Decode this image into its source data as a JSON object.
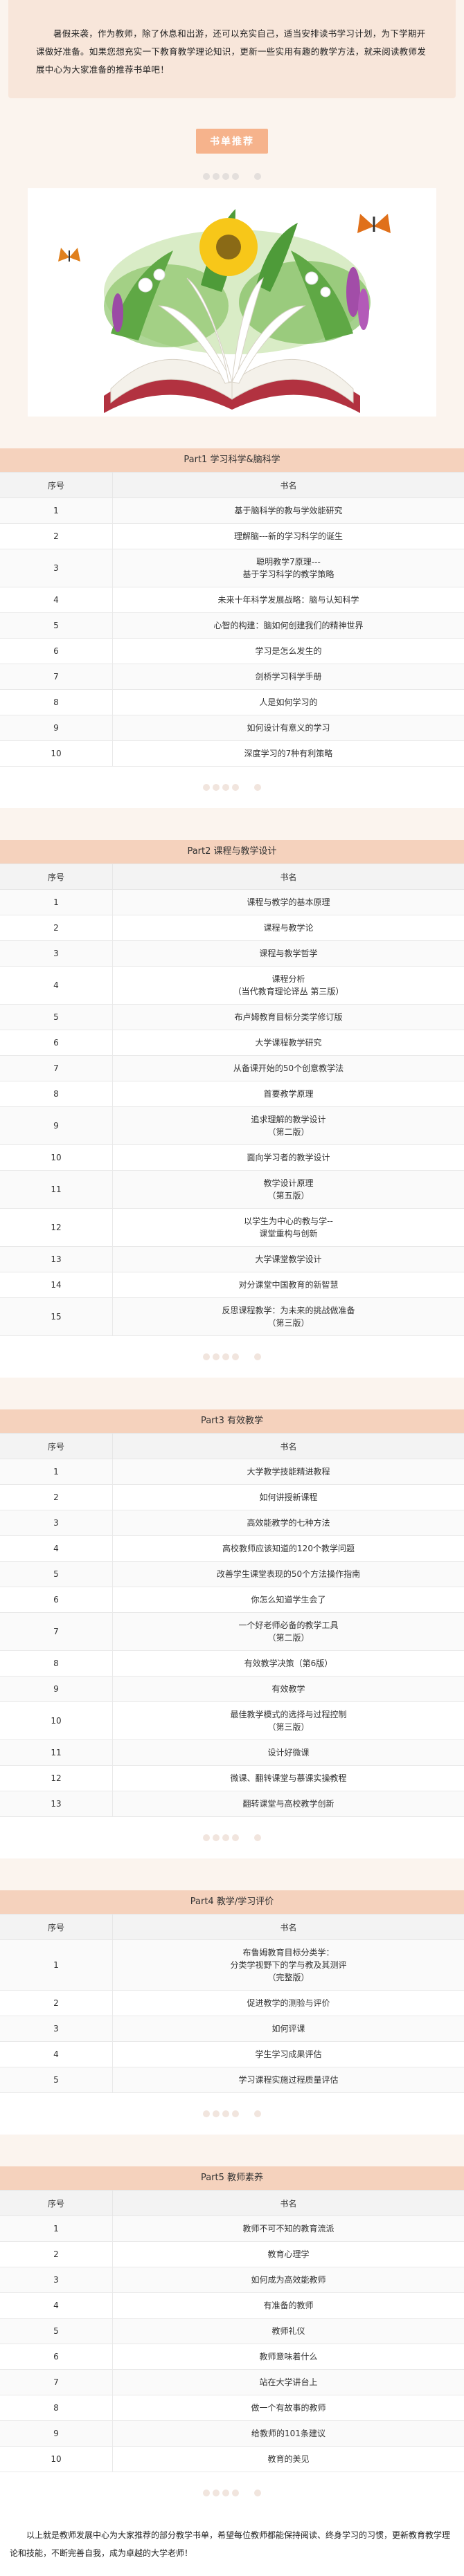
{
  "intro": "暑假来袭，作为教师，除了休息和出游，还可以充实自己，适当安排读书学习计划，为下学期开课做好准备。如果您想充实一下教育教学理论知识，更新一些实用有趣的教学方法，就来阅读教师发展中心为大家准备的推荐书单吧！",
  "tag_label": "书单推荐",
  "table_headers": {
    "index": "序号",
    "title": "书名"
  },
  "sections": [
    {
      "title": "Part1  学习科学&脑科学",
      "rows": [
        [
          "1",
          "基于脑科学的教与学效能研究"
        ],
        [
          "2",
          "理解脑---新的学习科学的诞生"
        ],
        [
          "3",
          "聪明教学7原理---\n基于学习科学的教学策略"
        ],
        [
          "4",
          "未来十年科学发展战略：脑与认知科学"
        ],
        [
          "5",
          "心智的构建：脑如何创建我们的精神世界"
        ],
        [
          "6",
          "学习是怎么发生的"
        ],
        [
          "7",
          "剑桥学习科学手册"
        ],
        [
          "8",
          "人是如何学习的"
        ],
        [
          "9",
          "如何设计有意义的学习"
        ],
        [
          "10",
          "深度学习的7种有利策略"
        ]
      ]
    },
    {
      "title": "Part2  课程与教学设计",
      "rows": [
        [
          "1",
          "课程与教学的基本原理"
        ],
        [
          "2",
          "课程与教学论"
        ],
        [
          "3",
          "课程与教学哲学"
        ],
        [
          "4",
          "课程分析\n（当代教育理论译丛 第三版）"
        ],
        [
          "5",
          "布卢姆教育目标分类学修订版"
        ],
        [
          "6",
          "大学课程教学研究"
        ],
        [
          "7",
          "从备课开始的50个创意教学法"
        ],
        [
          "8",
          "首要教学原理"
        ],
        [
          "9",
          "追求理解的教学设计\n（第二版）"
        ],
        [
          "10",
          "面向学习者的教学设计"
        ],
        [
          "11",
          "教学设计原理\n（第五版）"
        ],
        [
          "12",
          "以学生为中心的教与学--\n课堂重构与创新"
        ],
        [
          "13",
          "大学课堂教学设计"
        ],
        [
          "14",
          "对分课堂中国教育的新智慧"
        ],
        [
          "15",
          "反思课程教学：为未来的挑战做准备\n（第三版）"
        ]
      ]
    },
    {
      "title": "Part3  有效教学",
      "rows": [
        [
          "1",
          "大学教学技能精进教程"
        ],
        [
          "2",
          "如何讲授新课程"
        ],
        [
          "3",
          "高效能教学的七种方法"
        ],
        [
          "4",
          "高校教师应该知道的120个教学问题"
        ],
        [
          "5",
          "改善学生课堂表现的50个方法操作指南"
        ],
        [
          "6",
          "你怎么知道学生会了"
        ],
        [
          "7",
          "一个好老师必备的教学工具\n（第二版）"
        ],
        [
          "8",
          "有效教学决策（第6版）"
        ],
        [
          "9",
          "有效教学"
        ],
        [
          "10",
          "最佳教学模式的选择与过程控制\n（第三版）"
        ],
        [
          "11",
          "设计好微课"
        ],
        [
          "12",
          "微课、翻转课堂与慕课实操教程"
        ],
        [
          "13",
          "翻转课堂与高校教学创新"
        ]
      ]
    },
    {
      "title": "Part4  教学/学习评价",
      "rows": [
        [
          "1",
          "布鲁姆教育目标分类学：\n分类学视野下的学与教及其测评\n（完整版）"
        ],
        [
          "2",
          "促进教学的测验与评价"
        ],
        [
          "3",
          "如何评课"
        ],
        [
          "4",
          "学生学习成果评估"
        ],
        [
          "5",
          "学习课程实施过程质量评估"
        ]
      ]
    },
    {
      "title": "Part5  教师素养",
      "rows": [
        [
          "1",
          "教师不可不知的教育流派"
        ],
        [
          "2",
          "教育心理学"
        ],
        [
          "3",
          "如何成为高效能教师"
        ],
        [
          "4",
          "有准备的教师"
        ],
        [
          "5",
          "教师礼仪"
        ],
        [
          "6",
          "教师意味着什么"
        ],
        [
          "7",
          "站在大学讲台上"
        ],
        [
          "8",
          "做一个有故事的教师"
        ],
        [
          "9",
          "给教师的101条建议"
        ],
        [
          "10",
          "教育的美见"
        ]
      ]
    }
  ],
  "footer": "以上就是教师发展中心为大家推荐的部分教学书单，希望每位教师都能保持阅读、终身学习的习惯，更新教育教学理论和技能，不断完善自我，成为卓越的大学老师！",
  "colors": {
    "background": "#fbf4ee",
    "intro_bg": "#f8e6da",
    "tag_bg": "#f6b38c",
    "section_title_bg": "#f5d2bd"
  }
}
